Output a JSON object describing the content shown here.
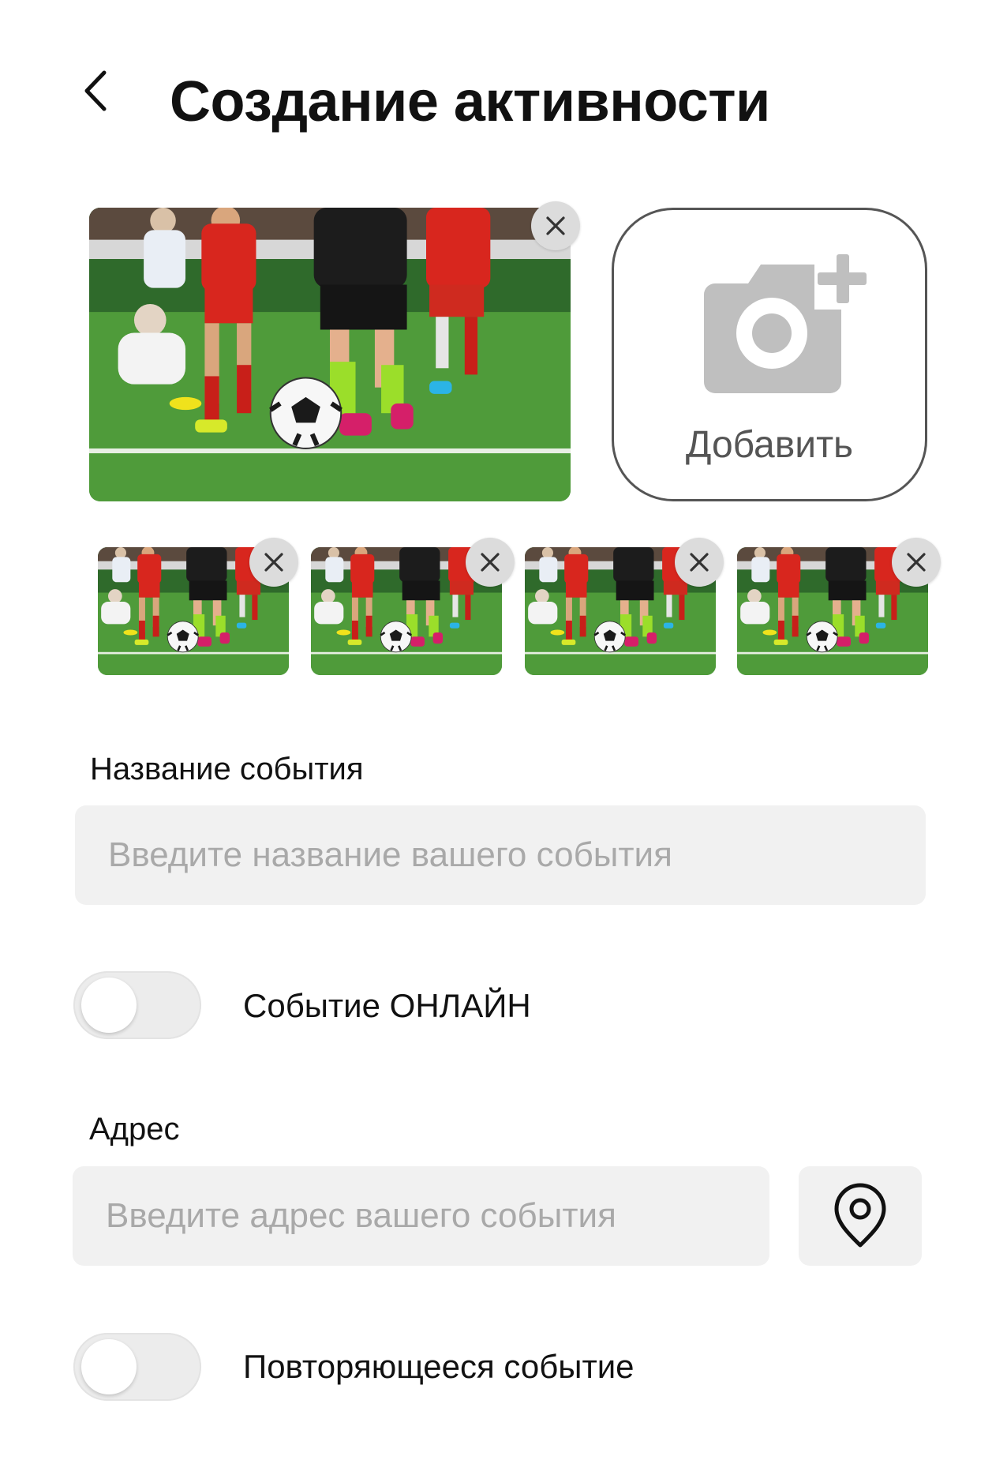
{
  "header": {
    "title": "Создание активности",
    "back_icon": "chevron-left-icon"
  },
  "photos": {
    "add_label": "Добавить",
    "add_icon": "camera-plus-icon",
    "remove_icon": "close-icon",
    "thumbnail_count": 4
  },
  "event_name": {
    "label": "Название события",
    "placeholder": "Введите название вашего события",
    "value": ""
  },
  "online_toggle": {
    "label": "Событие ОНЛАЙН",
    "enabled": false
  },
  "address": {
    "label": "Адрес",
    "placeholder": "Введите адрес вашего события",
    "value": "",
    "location_icon": "location-pin-icon"
  },
  "recurring_toggle": {
    "label": "Повторяющееся событие",
    "enabled": false
  },
  "colors": {
    "field_bg": "#f1f1f1",
    "placeholder": "#a9a9a9",
    "icon_gray": "#bfbfbf",
    "border": "#555555"
  }
}
